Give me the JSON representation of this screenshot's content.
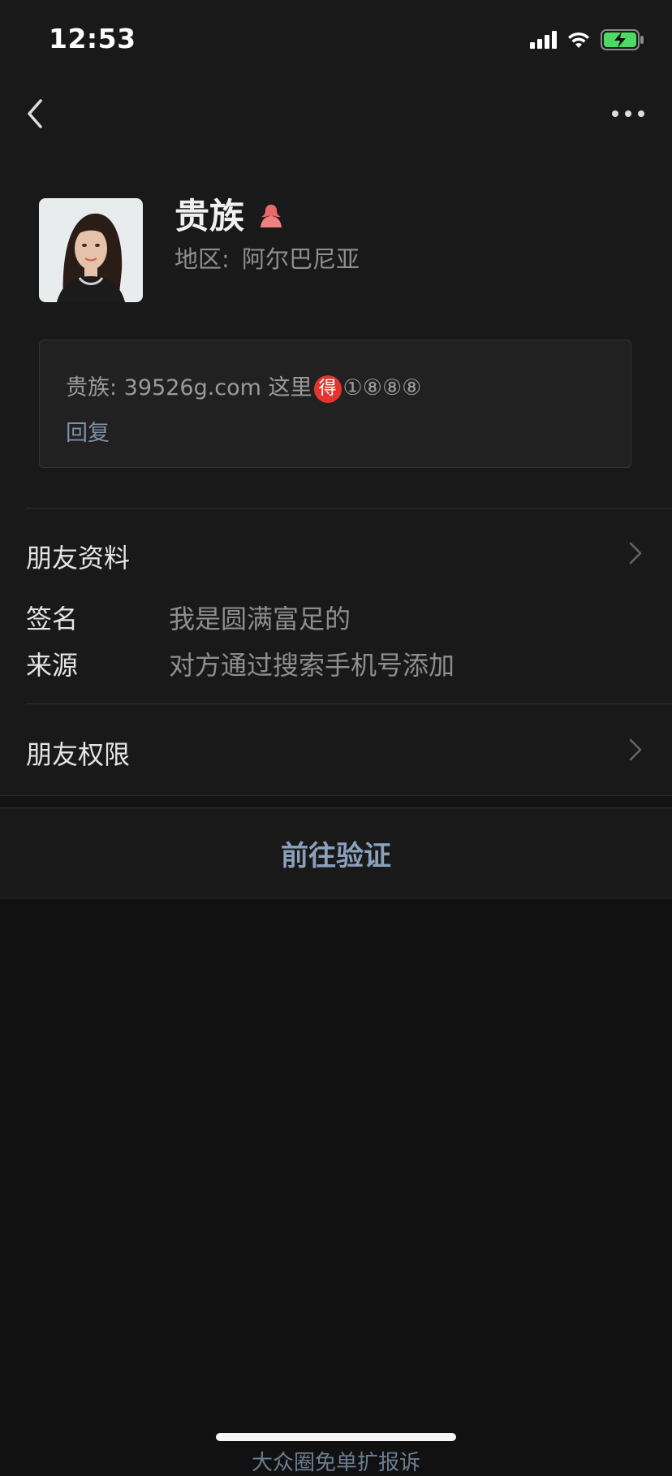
{
  "status_bar": {
    "time": "12:53",
    "icons": [
      "signal-icon",
      "wifi-icon",
      "battery-charging-icon"
    ]
  },
  "nav": {
    "back_icon": "chevron-left-icon",
    "more_icon": "more-dots-icon"
  },
  "profile": {
    "nickname": "贵族",
    "gender_icon": "female-user-icon",
    "region_label": "地区:",
    "region_value": "阿尔巴尼亚"
  },
  "message": {
    "prefix": "贵族: 39526g.com 这里",
    "emoji": "得",
    "suffix": "①⑧⑧⑧",
    "reply_label": "回复"
  },
  "friend_info": {
    "title": "朋友资料",
    "signature_label": "签名",
    "signature_value": "我是圆满富足的",
    "source_label": "来源",
    "source_value": "对方通过搜索手机号添加"
  },
  "permissions": {
    "title": "朋友权限"
  },
  "action": {
    "verify_label": "前往验证"
  },
  "footer": {
    "link_text": "大众圈免单扩报诉"
  },
  "colors": {
    "page_background": "#111111",
    "card_background": "#191919",
    "link_blue": "#8aa1bd",
    "emoji_red": "#e4342f"
  }
}
